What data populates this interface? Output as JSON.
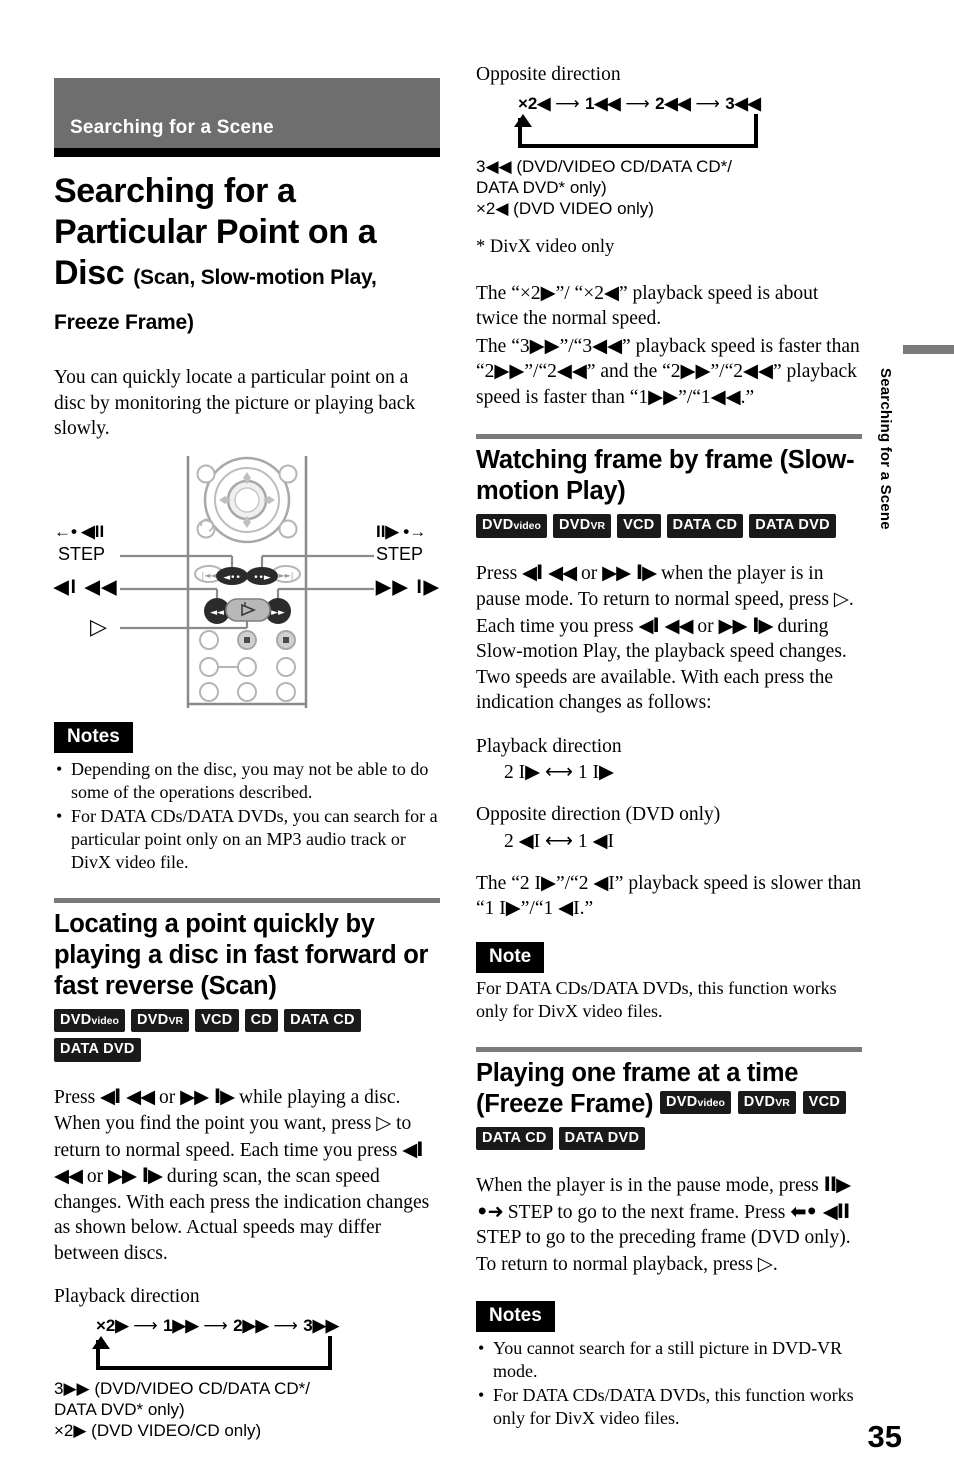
{
  "chapter": {
    "banner_label": "Searching for a Scene"
  },
  "title": {
    "main": "Searching for a Particular Point on a Disc",
    "sub": "(Scan, Slow-motion Play, Freeze Frame)"
  },
  "intro": "You can quickly locate a particular point on a disc by monitoring the picture or playing back slowly.",
  "remote": {
    "label_left_top": "←• ◀II",
    "label_left_step": "STEP",
    "label_right_top": "II▶ •→",
    "label_right_step": "STEP",
    "label_left_rev": "◀I ◀◀",
    "label_right_fwd": "▶▶ I▶",
    "label_play": "▷"
  },
  "notes_top": {
    "tag": "Notes",
    "items": [
      "Depending on the disc, you may not be able to do some of the operations described.",
      "For DATA CDs/DATA DVDs, you can search for a particular point only on an MP3 audio track or DivX video file."
    ]
  },
  "section_scan": {
    "heading": "Locating a point quickly by playing a disc in fast forward or fast reverse (Scan)",
    "badges": [
      "DVDvideo",
      "DVDvr",
      "VCD",
      "CD",
      "DATA CD",
      "DATA DVD"
    ],
    "paragraph_parts": {
      "p1": "Press ",
      "p2": " or ",
      "p3": " while playing a disc. When you find the point you want, press ",
      "p4": " to return to normal speed. Each time you press ",
      "p5": " or ",
      "p6": " during scan, the scan speed changes. With each press the indication changes as shown below. Actual speeds may differ between discs."
    },
    "playback_direction_label": "Playback direction",
    "playback_sequence": [
      "×2▶",
      "1▶▶",
      "2▶▶",
      "3▶▶"
    ],
    "caption_line1": "3▶▶  (DVD/VIDEO CD/DATA CD*/",
    "caption_line2": "DATA DVD* only)",
    "caption_line3": "×2▶ (DVD VIDEO/CD only)"
  },
  "section_opposite": {
    "opposite_direction_label": "Opposite direction",
    "opposite_sequence": [
      "×2◀",
      "1◀◀",
      "2◀◀",
      "3◀◀"
    ],
    "caption_line1": "3◀◀ (DVD/VIDEO CD/DATA CD*/",
    "caption_line2": "DATA DVD* only)",
    "caption_line3": "×2◀ (DVD VIDEO only)",
    "footnote": "* DivX video only",
    "speed_text_1_a": "The “",
    "speed_text_1_b": "×2▶",
    "speed_text_1_c": "”/ “",
    "speed_text_1_d": "×2◀",
    "speed_text_1_e": "” playback speed is about twice the normal speed.",
    "speed_text_2": "The “3▶▶”/“3◀◀” playback speed is faster than “2▶▶”/“2◀◀” and the “2▶▶”/“2◀◀” playback speed is faster than “1▶▶”/“1◀◀.”"
  },
  "section_slow": {
    "heading": "Watching frame by frame (Slow-motion Play)",
    "badges": [
      "DVDvideo",
      "DVDvr",
      "VCD",
      "DATA CD",
      "DATA DVD"
    ],
    "paragraph_parts": {
      "p1": "Press ",
      "p2": " or ",
      "p3": " when the player is in pause mode. To return to normal speed, press ",
      "p4": ".",
      "p5": "Each time you press ",
      "p6": " or ",
      "p7": " during Slow-motion Play, the playback speed changes. Two speeds are available. With each press the indication changes as follows:"
    },
    "playback_direction_label": "Playback direction",
    "playback_sequence": "2 I▶   ⟷ 1 I▶",
    "opposite_direction_label": "Opposite direction (DVD only)",
    "opposite_sequence": "2 ◀I  ⟷ 1 ◀I",
    "speed_text": "The “2 I▶”/“2 ◀I” playback speed is slower than “1 I▶”/“1 ◀I.”"
  },
  "note_slow": {
    "tag": "Note",
    "body": "For DATA CDs/DATA DVDs, this function works only for DivX video files."
  },
  "section_freeze": {
    "heading": "Playing one frame at a time (Freeze Frame)",
    "badges_inline": [
      "DVDvideo",
      "DVDvr",
      "VCD"
    ],
    "badges_row2": [
      "DATA CD",
      "DATA DVD"
    ],
    "paragraph_parts": {
      "p1": "When the player is in the pause mode, press ",
      "p2": " STEP to go to the next frame. Press ",
      "p3": " STEP to go to the preceding frame (DVD only). To return to normal playback, press ",
      "p4": "."
    }
  },
  "notes_bottom": {
    "tag": "Notes",
    "items": [
      "You cannot search for a still picture in DVD-VR mode.",
      "For DATA CDs/DATA DVDs, this function works only for DivX video files."
    ]
  },
  "thumb_tab": {
    "label": "Searching for a Scene"
  },
  "page_number": "35",
  "colors": {
    "banner_gray": "#6e6e6e",
    "divider_gray": "#7a7a7a",
    "badge_black": "#1a1a1a"
  }
}
